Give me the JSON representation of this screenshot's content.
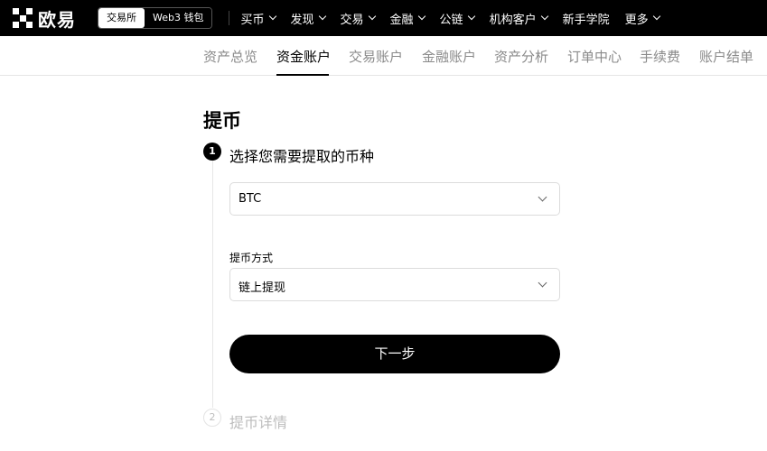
{
  "header": {
    "logo_text": "欧易",
    "switch": {
      "exchange": "交易所",
      "wallet": "Web3 钱包"
    },
    "nav": [
      {
        "label": "买币",
        "has_menu": true
      },
      {
        "label": "发现",
        "has_menu": true
      },
      {
        "label": "交易",
        "has_menu": true
      },
      {
        "label": "金融",
        "has_menu": true
      },
      {
        "label": "公链",
        "has_menu": true
      },
      {
        "label": "机构客户",
        "has_menu": true
      },
      {
        "label": "新手学院",
        "has_menu": false
      },
      {
        "label": "更多",
        "has_menu": true
      }
    ]
  },
  "subnav": {
    "tabs": [
      {
        "label": "资产总览"
      },
      {
        "label": "资金账户",
        "active": true
      },
      {
        "label": "交易账户"
      },
      {
        "label": "金融账户"
      },
      {
        "label": "资产分析"
      },
      {
        "label": "订单中心"
      },
      {
        "label": "手续费"
      },
      {
        "label": "账户结单"
      }
    ]
  },
  "main": {
    "title": "提币",
    "step1": {
      "number": "1",
      "title": "选择您需要提取的币种"
    },
    "coin_select": {
      "value": "BTC"
    },
    "method": {
      "label": "提币方式",
      "value": "链上提现"
    },
    "next_button": "下一步",
    "step2": {
      "number": "2",
      "title": "提币详情"
    }
  }
}
